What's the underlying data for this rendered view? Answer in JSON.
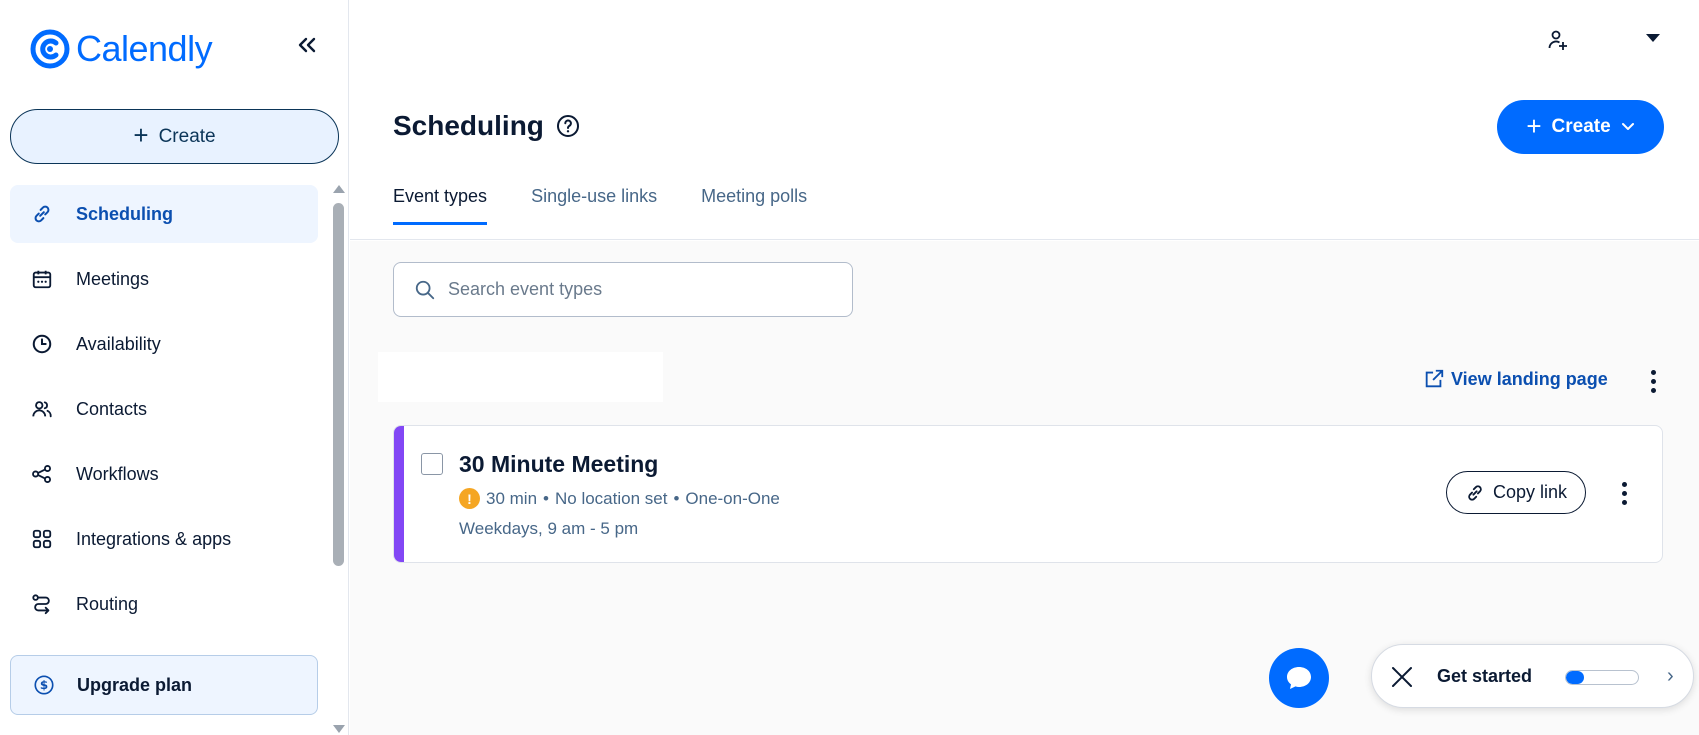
{
  "brand": {
    "name": "Calendly",
    "color": "#006bff"
  },
  "sidebar": {
    "create_label": "Create",
    "items": [
      {
        "label": "Scheduling",
        "icon": "link-icon",
        "active": true
      },
      {
        "label": "Meetings",
        "icon": "calendar-icon",
        "active": false
      },
      {
        "label": "Availability",
        "icon": "clock-icon",
        "active": false
      },
      {
        "label": "Contacts",
        "icon": "contacts-icon",
        "active": false
      },
      {
        "label": "Workflows",
        "icon": "workflows-icon",
        "active": false
      },
      {
        "label": "Integrations & apps",
        "icon": "apps-grid-icon",
        "active": false
      },
      {
        "label": "Routing",
        "icon": "routing-icon",
        "active": false
      }
    ],
    "upgrade_label": "Upgrade plan"
  },
  "header": {
    "title": "Scheduling",
    "create_label": "Create"
  },
  "tabs": [
    {
      "label": "Event types",
      "active": true
    },
    {
      "label": "Single-use links",
      "active": false
    },
    {
      "label": "Meeting polls",
      "active": false
    }
  ],
  "search": {
    "placeholder": "Search event types",
    "value": ""
  },
  "landing": {
    "label": "View landing page"
  },
  "event": {
    "title": "30 Minute Meeting",
    "duration": "30 min",
    "location": "No location set",
    "type": "One-on-One",
    "separator": "•",
    "schedule": "Weekdays, 9 am - 5 pm",
    "copy_label": "Copy link",
    "color": "#8247f5"
  },
  "get_started": {
    "label": "Get started",
    "progress": 0.25
  }
}
